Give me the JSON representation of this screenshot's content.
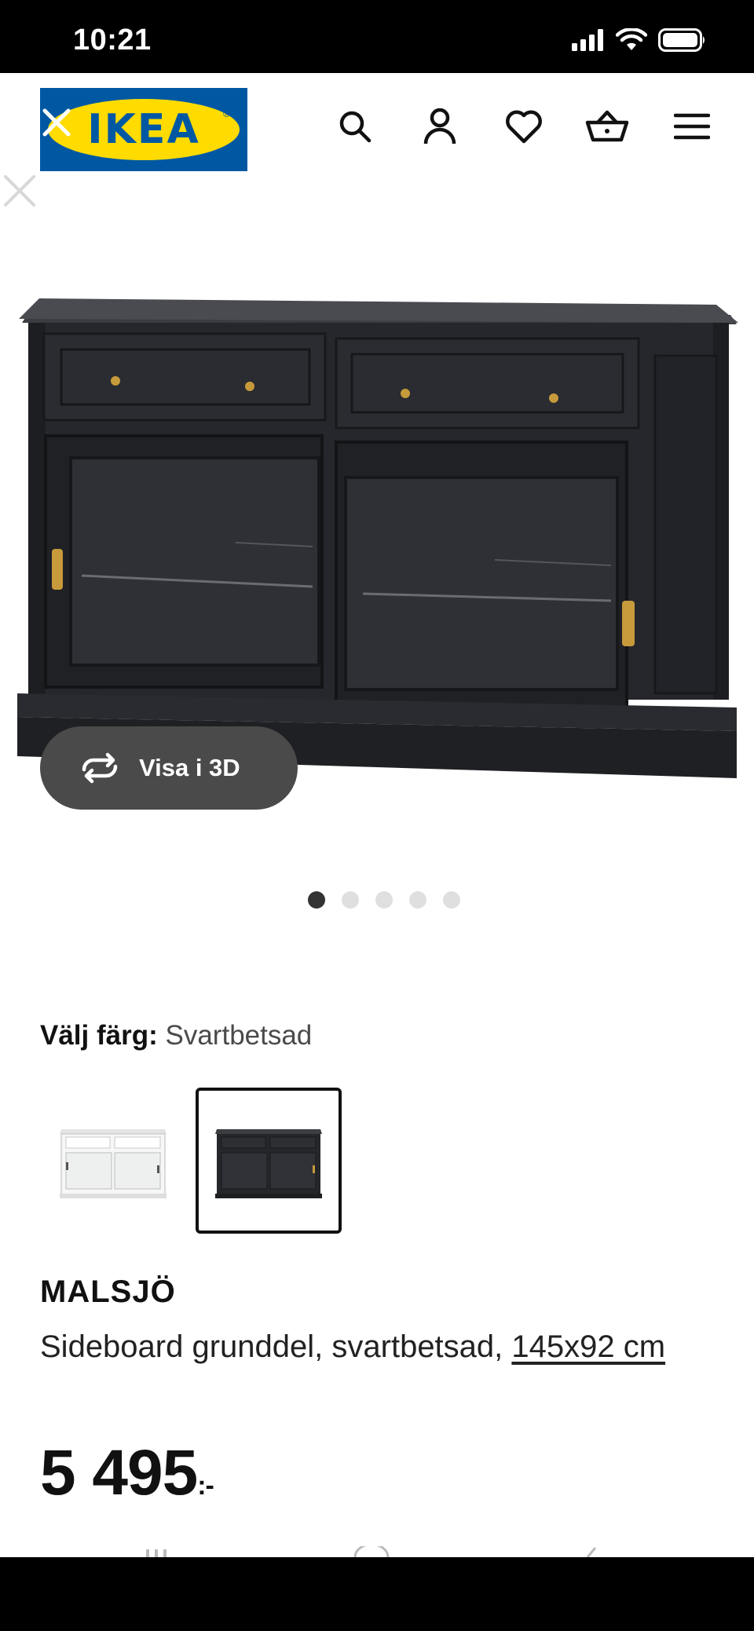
{
  "status_bar": {
    "time": "10:21"
  },
  "header": {
    "logo_text": "IKEA",
    "icons": [
      "search-icon",
      "account-icon",
      "heart-icon",
      "basket-icon",
      "menu-icon"
    ]
  },
  "hero": {
    "view_3d_label": "Visa i 3D",
    "image_count": 5,
    "active_image": 1
  },
  "color_selector": {
    "label": "Välj färg:",
    "value": "Svartbetsad",
    "options": [
      {
        "name": "white",
        "selected": false
      },
      {
        "name": "black-brown",
        "selected": true
      }
    ]
  },
  "product": {
    "name": "MALSJÖ",
    "description": "Sideboard grunddel, svartbetsad, ",
    "dimensions": "145x92 cm",
    "price": "5 495",
    "price_suffix": ":-"
  },
  "colors": {
    "ikea_blue": "#0058a3",
    "ikea_yellow": "#ffdb00",
    "button_bg": "#4a4a4a",
    "furniture": "#24252a",
    "brass": "#c79a3b"
  }
}
